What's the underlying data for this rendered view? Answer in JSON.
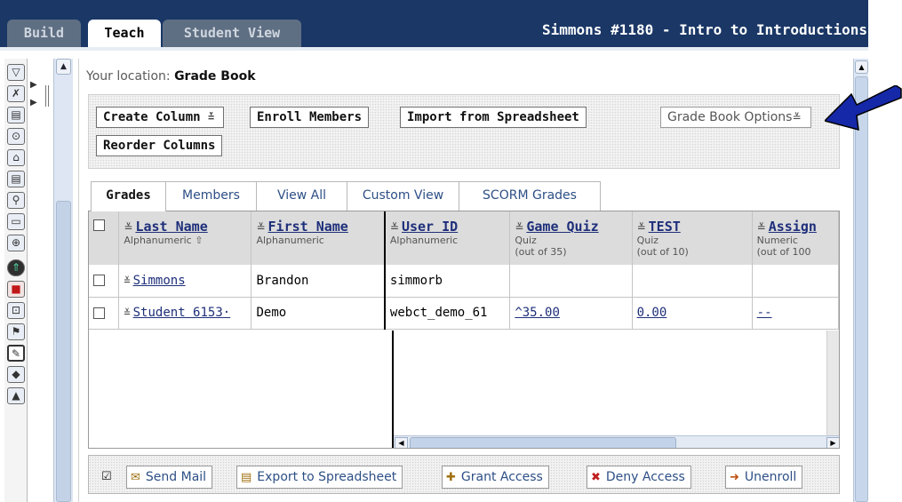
{
  "top_tabs": [
    {
      "label": "Build"
    },
    {
      "label": "Teach"
    },
    {
      "label": "Student View"
    }
  ],
  "course_title": "Simmons #1180 - Intro to Introductions",
  "location": {
    "prefix": "Your location:",
    "current": "Grade Book"
  },
  "actions": {
    "create_column": "Create Column",
    "enroll_members": "Enroll Members",
    "import_spreadsheet": "Import from Spreadsheet",
    "reorder_columns": "Reorder Columns",
    "grade_book_options": "Grade Book Options"
  },
  "sub_tabs": [
    "Grades",
    "Members",
    "View All",
    "Custom View",
    "SCORM Grades"
  ],
  "columns": [
    {
      "label": "Last Name",
      "type": "Alphanumeric ⇧",
      "sub": ""
    },
    {
      "label": "First Name",
      "type": "Alphanumeric",
      "sub": ""
    },
    {
      "label": "User ID",
      "type": "Alphanumeric",
      "sub": ""
    },
    {
      "label": "Game Quiz",
      "type": "Quiz",
      "sub": "(out of 35)"
    },
    {
      "label": "TEST",
      "type": "Quiz",
      "sub": "(out of 10)"
    },
    {
      "label": "Assign",
      "type": "Numeric",
      "sub": "(out of 100"
    }
  ],
  "rows": [
    {
      "last": "Simmons",
      "first": "Brandon",
      "user_id": "simmorb",
      "game_quiz": "",
      "test": "",
      "assign": ""
    },
    {
      "last": "Student 6153·",
      "first": "Demo",
      "user_id": "webct_demo_61",
      "game_quiz": "^35.00",
      "test": "0.00",
      "assign": "--"
    }
  ],
  "bottom_actions": {
    "send_mail": "Send Mail",
    "export_spreadsheet": "Export to Spreadsheet",
    "grant_access": "Grant Access",
    "deny_access": "Deny Access",
    "unenroll": "Unenroll"
  },
  "colors": {
    "header_navy": "#1a3766",
    "link_blue": "#1e2f7a",
    "arrow_blue": "#1528a8"
  }
}
